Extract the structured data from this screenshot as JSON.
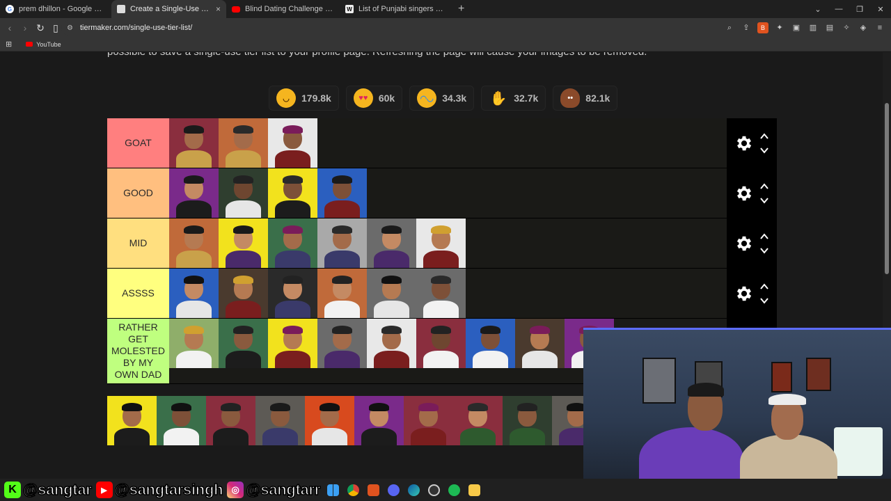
{
  "browser": {
    "tabs": [
      {
        "title": "prem dhillon - Google Search",
        "icon": "google-icon",
        "active": false
      },
      {
        "title": "Create a Single-Use Tier List (Pri",
        "icon": "tiermaker-icon",
        "active": true
      },
      {
        "title": "Blind Dating Challenge | Who Will Ki",
        "icon": "youtube-icon",
        "active": false
      },
      {
        "title": "List of Punjabi singers - Wikipedia",
        "icon": "wikipedia-icon",
        "active": false
      }
    ],
    "close_tab_glyph": "×",
    "new_tab_glyph": "+",
    "url": "tiermaker.com/single-use-tier-list/",
    "bookmarks": [
      {
        "label": "YouTube",
        "icon": "youtube-icon"
      }
    ]
  },
  "page": {
    "intro_text": "possible to save a single-use tier list to your profile page. Refreshing the page will cause your images to be removed.",
    "reactions": [
      {
        "emoji": "grinning-face-icon",
        "count": "179.8k",
        "color": "#f5b51f"
      },
      {
        "emoji": "heart-eyes-icon",
        "count": "60k",
        "color": "#f5b51f"
      },
      {
        "emoji": "tears-of-joy-icon",
        "count": "34.3k",
        "color": "#f5b51f"
      },
      {
        "emoji": "raised-hands-icon",
        "count": "32.7k",
        "color": "#f5b51f"
      },
      {
        "emoji": "poop-icon",
        "count": "82.1k",
        "color": "#8a4a2a"
      }
    ],
    "tiers": [
      {
        "label": "GOAT",
        "color": "#ff7f7f",
        "count": 3
      },
      {
        "label": "GOOD",
        "color": "#ffbf7f",
        "count": 4
      },
      {
        "label": "MID",
        "color": "#ffdf7f",
        "count": 6
      },
      {
        "label": "ASSSS",
        "color": "#ffff7f",
        "count": 6
      },
      {
        "label": "RATHER GET MOLESTED BY MY OWN DAD",
        "color": "#bfff7f",
        "count": 9
      }
    ]
  },
  "social": [
    {
      "platform": "kick",
      "icon": "kick-icon",
      "handle": "@sangtar",
      "color": "#53fc18"
    },
    {
      "platform": "youtube",
      "icon": "youtube-icon",
      "handle": "@sangtarsingh",
      "color": "#ff0000"
    },
    {
      "platform": "instagram",
      "icon": "instagram-icon",
      "handle": "@sangtarr",
      "color": "#d62976"
    }
  ]
}
